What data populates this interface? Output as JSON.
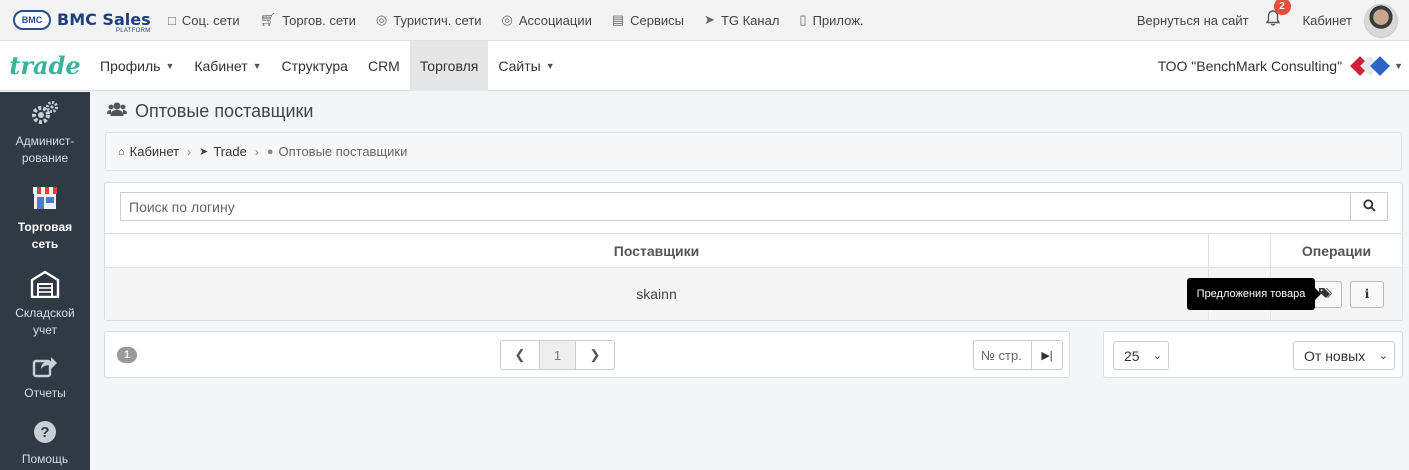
{
  "topbar": {
    "logo_badge": "BMC",
    "logo_title": "BMC Sales",
    "logo_subtitle": "PLATFORM",
    "nav": [
      {
        "label": "Соц. сети",
        "icon": "chat-icon"
      },
      {
        "label": "Торгов. сети",
        "icon": "cart-icon"
      },
      {
        "label": "Туристич. сети",
        "icon": "globe-icon"
      },
      {
        "label": "Ассоциации",
        "icon": "ball-icon"
      },
      {
        "label": "Сервисы",
        "icon": "briefcase-icon"
      },
      {
        "label": "TG Канал",
        "icon": "send-icon"
      },
      {
        "label": "Прилож.",
        "icon": "mobile-icon"
      }
    ],
    "back_link": "Вернуться на сайт",
    "notifications_count": "2",
    "cabinet_link": "Кабинет"
  },
  "navbar": {
    "brand": "trade",
    "items": [
      {
        "label": "Профиль",
        "dropdown": true
      },
      {
        "label": "Кабинет",
        "dropdown": true
      },
      {
        "label": "Структура",
        "dropdown": false
      },
      {
        "label": "CRM",
        "dropdown": false
      },
      {
        "label": "Торговля",
        "dropdown": false,
        "active": true
      },
      {
        "label": "Сайты",
        "dropdown": true
      }
    ],
    "organization": "ТОО \"BenchMark Consulting\""
  },
  "sidebar": {
    "items": [
      {
        "label": "Админист-рование",
        "icon": "gears-icon"
      },
      {
        "label": "Торговая сеть",
        "icon": "store-icon",
        "active": true
      },
      {
        "label": "Складской учет",
        "icon": "warehouse-icon"
      },
      {
        "label": "Отчеты",
        "icon": "share-icon"
      },
      {
        "label": "Помощь",
        "icon": "question-icon"
      }
    ]
  },
  "page": {
    "title": "Оптовые поставщики",
    "breadcrumb": [
      "Кабинет",
      "Trade",
      "Оптовые поставщики"
    ]
  },
  "search": {
    "placeholder": "Поиск по логину"
  },
  "table": {
    "headers": [
      "Поставщики",
      "",
      "Операции"
    ],
    "rows": [
      {
        "supplier": "skainn"
      }
    ]
  },
  "tooltip": "Предложения товара",
  "pagination": {
    "total": "1",
    "current_page": "1",
    "goto_placeholder": "№ стр."
  },
  "sorting": {
    "per_page": "25",
    "order": "От новых"
  },
  "colors": {
    "sidebar_bg": "#2f3a45",
    "brand": "#3bb39a",
    "badge": "#e74c3c"
  }
}
